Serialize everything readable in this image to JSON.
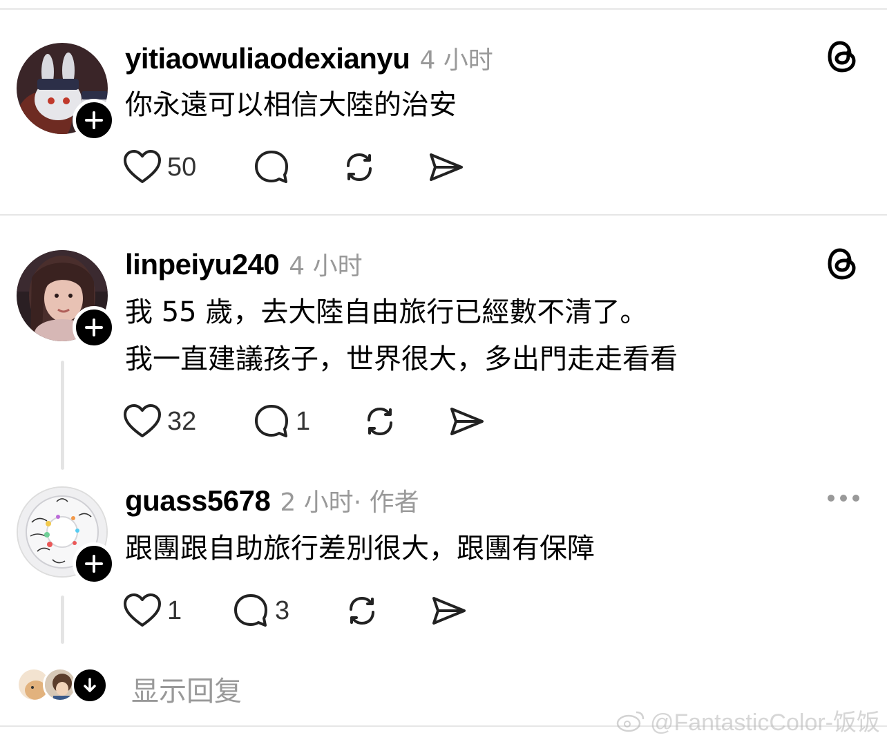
{
  "posts": [
    {
      "username": "yitiaowuliaodexianyu",
      "time": "4 小时",
      "text_lines": [
        "你永遠可以相信大陸的治安"
      ],
      "likes": "50",
      "replies": "",
      "corner_icon": "threads-logo-icon"
    },
    {
      "username": "linpeiyu240",
      "time": "4 小时",
      "text_lines": [
        "我 55 歲，去大陸自由旅行已經數不清了。",
        "我一直建議孩子，世界很大，多出門走走看看"
      ],
      "likes": "32",
      "replies": "1",
      "corner_icon": "threads-logo-icon"
    },
    {
      "username": "guass5678",
      "time": "2 小时",
      "role": " · 作者",
      "text_lines": [
        "跟團跟自助旅行差別很大，跟團有保障"
      ],
      "likes": "1",
      "replies": "3",
      "corner_icon": "more-icon"
    }
  ],
  "show_replies_label": "显示回复",
  "watermark": "@FantasticColor-饭饭",
  "colors": {
    "text": "#000000",
    "muted": "#999999",
    "divider": "#e6e6e6",
    "thread_line": "#e4e4e4"
  }
}
